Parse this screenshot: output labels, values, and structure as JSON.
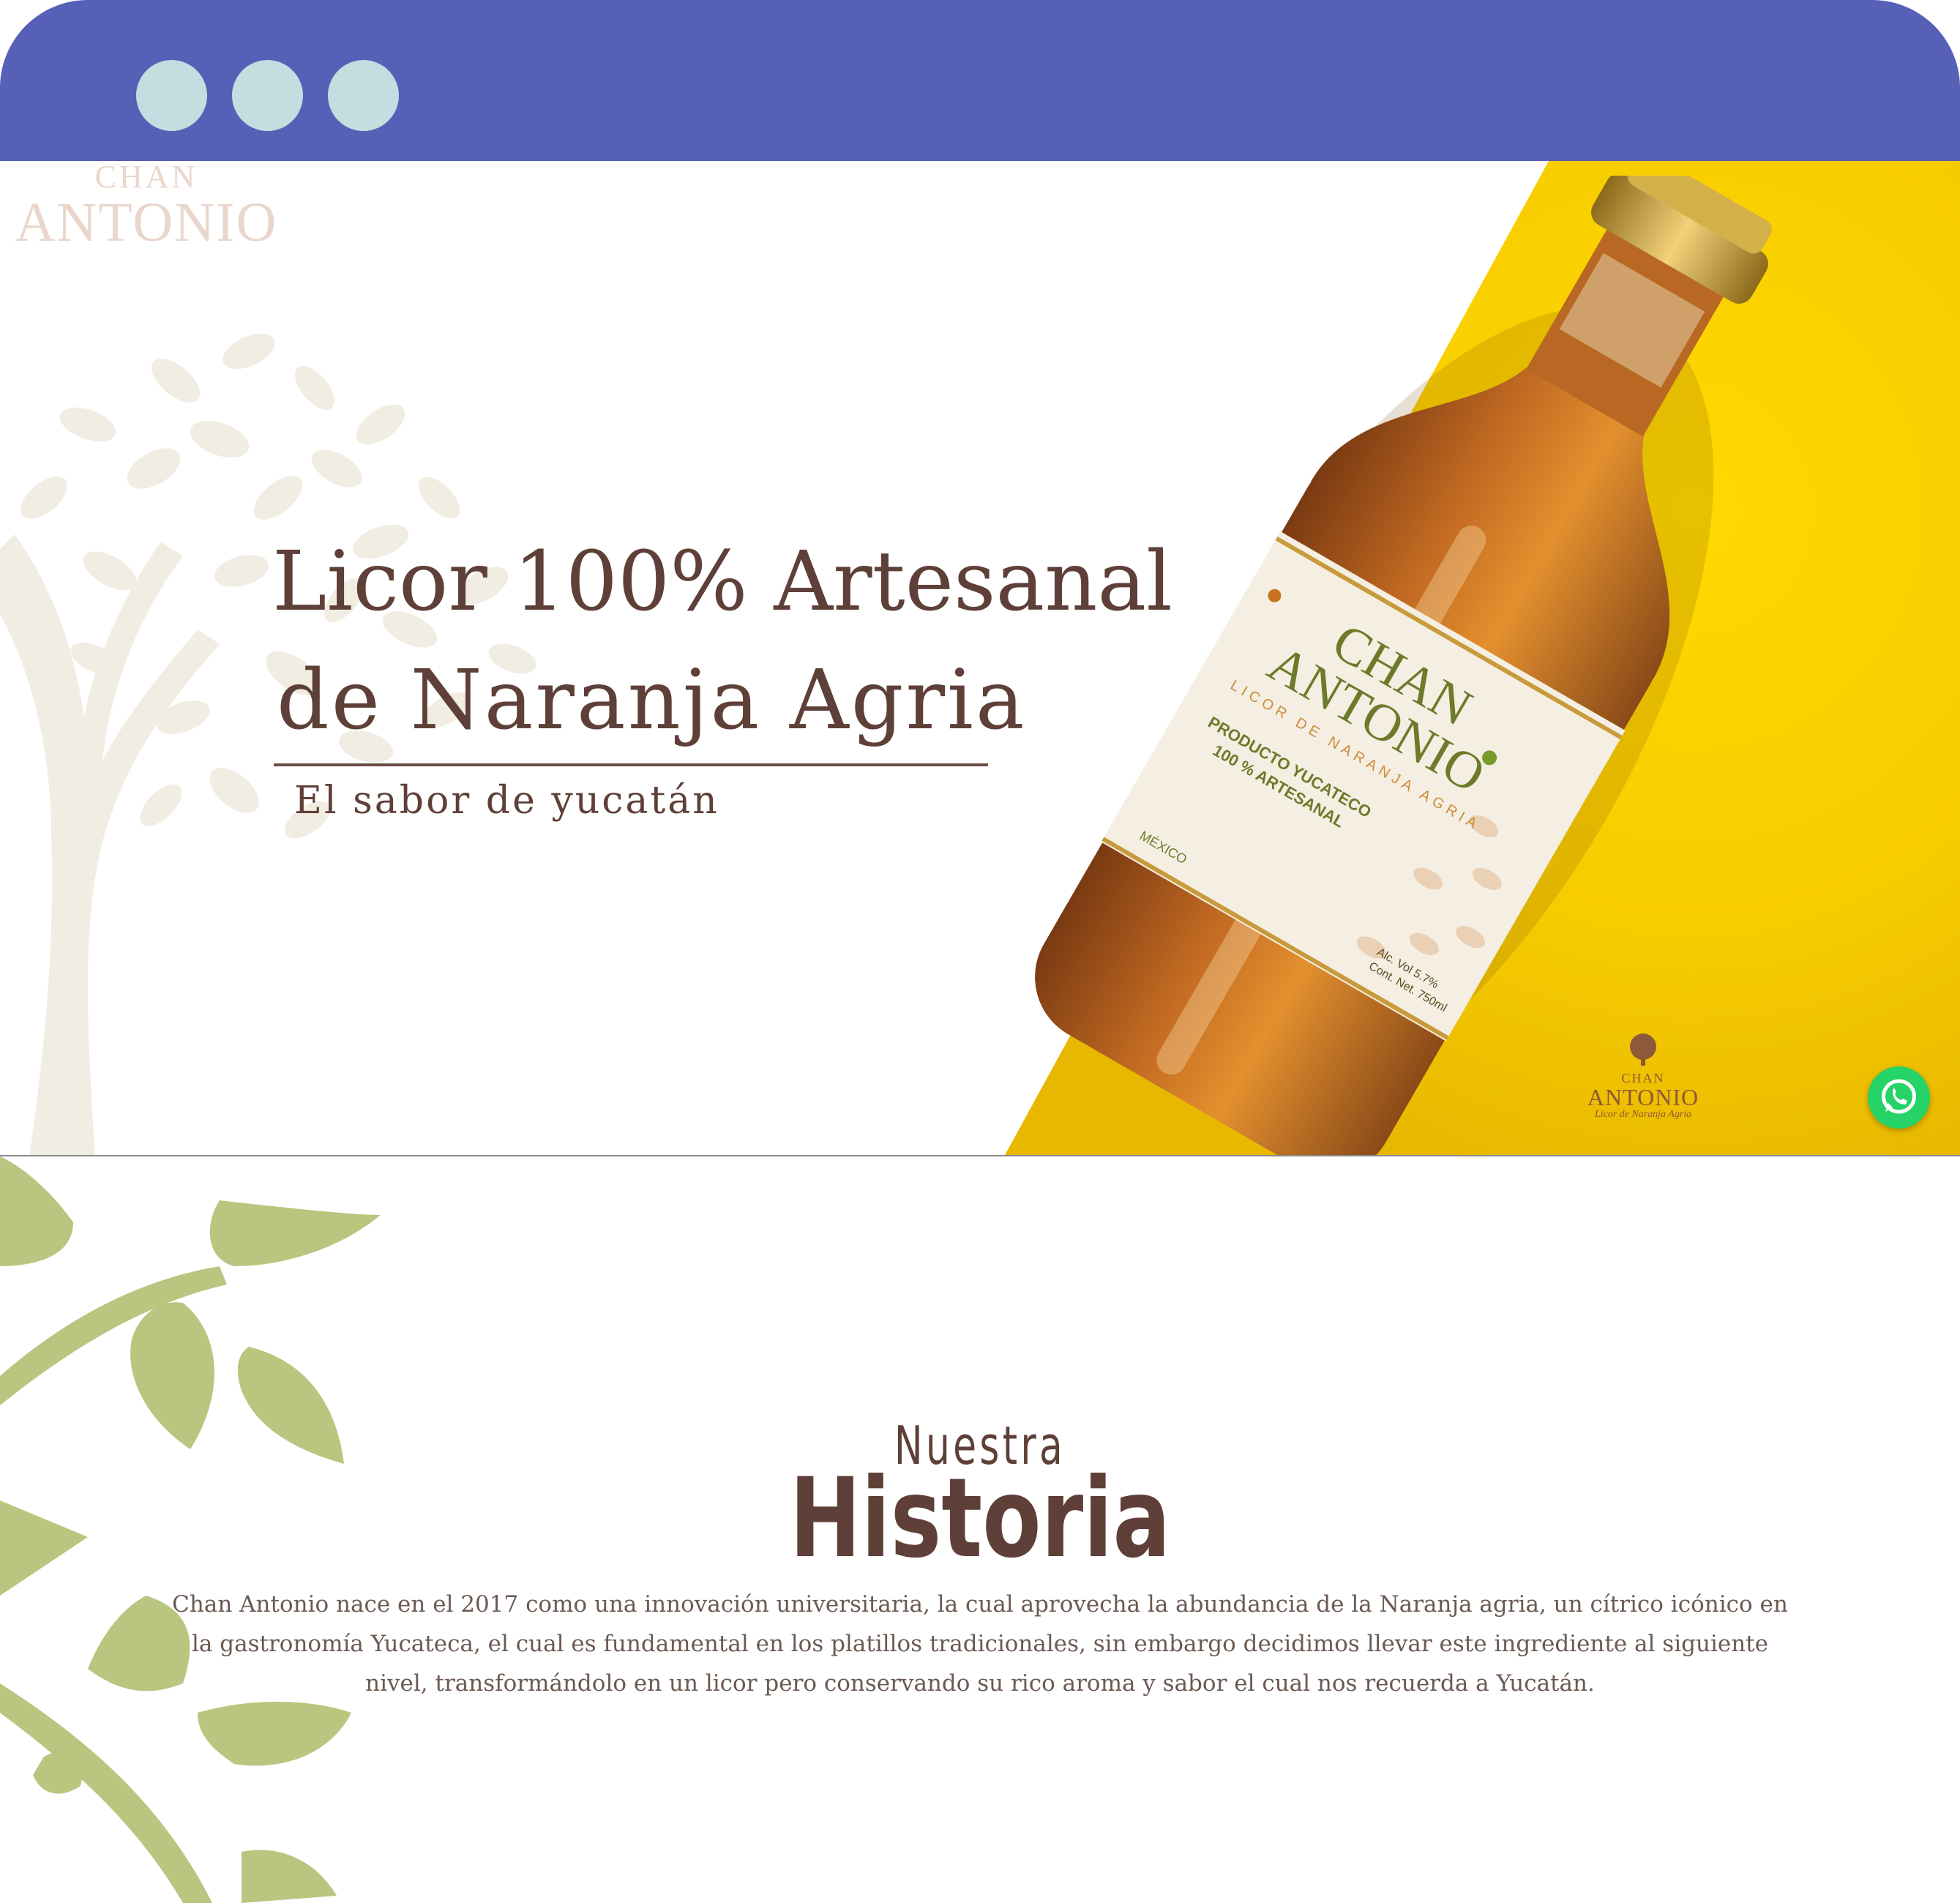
{
  "window": {
    "controls": [
      "window-dot",
      "window-dot",
      "window-dot"
    ],
    "titlebar_color": "#5560b6",
    "dot_color": "#c3dde0"
  },
  "hero": {
    "watermark_logo": {
      "small": "CHAN",
      "big": "ANTONIO"
    },
    "title_line1": "Licor 100% Artesanal",
    "title_line2": "de Naranja Agria",
    "subtitle": "El sabor de yucatán",
    "accent_yellow": "#f6cf00",
    "text_color": "#5e4038",
    "bottle_label": {
      "brand_line1": "CHAN",
      "brand_line2": "ANTONIO",
      "tagline": "LICOR DE NARANJA AGRIA",
      "product_line1": "PRODUCTO YUCATECO",
      "product_line2": "100 % ARTESANAL",
      "origin": "MÉXICO",
      "spec_line1": "Alc. Vol 5.7%",
      "spec_line2": "Cont. Net. 750ml"
    },
    "corner_logo": {
      "small": "CHAN",
      "big": "ANTONIO",
      "tag": "Licor de Naranja Agria"
    },
    "whatsapp_icon": "whatsapp-icon"
  },
  "history": {
    "kicker": "Nuestra",
    "title": "Historia",
    "body": "Chan Antonio nace en el 2017 como una innovación universitaria, la cual aprovecha la abundancia de la Naranja agria, un cítrico icónico en la gastronomía Yucateca, el cual es fundamental en los platillos tradicionales, sin embargo decidimos llevar este ingrediente al siguiente nivel, transformándolo en un licor pero conservando su rico aroma y sabor el cual nos recuerda a Yucatán.",
    "vine_color": "#b8c67f"
  }
}
